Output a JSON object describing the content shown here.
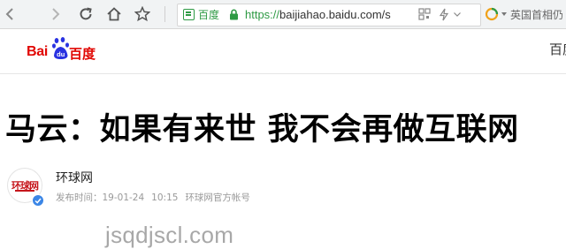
{
  "browser": {
    "site_badge": "百度",
    "url_scheme": "https://",
    "url_rest": "baijiahao.baidu.com/s",
    "hot_search": "英国首相仍",
    "accent_green": "#2e9a44"
  },
  "baidu_header": {
    "logo_latin_1": "Bai",
    "logo_latin_2": "du",
    "logo_cn": "百度",
    "nav_partial": "百度",
    "brand_red": "#e10602"
  },
  "article": {
    "title": "马云：如果有来世 我不会再做互联网",
    "author_name": "环球网",
    "avatar_text": "环球网",
    "publish_label": "发布时间：",
    "publish_date": "19-01-24",
    "publish_time": "10:15",
    "account_type": "环球网官方帐号"
  },
  "watermark": "jsqdjscl.com"
}
